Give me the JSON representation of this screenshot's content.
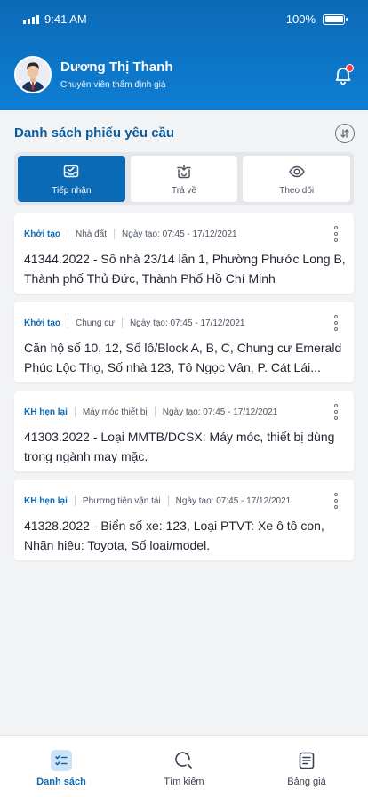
{
  "status_bar": {
    "time": "9:41 AM",
    "battery": "100%"
  },
  "user": {
    "name": "Dương Thị Thanh",
    "role": "Chuyên viên thẩm định giá"
  },
  "section": {
    "title": "Danh sách phiếu yêu cầu"
  },
  "tabs": [
    {
      "label": "Tiếp nhận",
      "icon": "inbox-check-icon",
      "active": true
    },
    {
      "label": "Trả về",
      "icon": "return-box-icon",
      "active": false
    },
    {
      "label": "Theo dõi",
      "icon": "eye-icon",
      "active": false
    }
  ],
  "requests": [
    {
      "status": "Khởi tạo",
      "category": "Nhà đất",
      "date": "Ngày tạo: 07:45 - 17/12/2021",
      "description": "41344.2022 - Số nhà 23/14 lần 1, Phường Phước Long B, Thành phố Thủ Đức, Thành Phố Hồ Chí Minh"
    },
    {
      "status": "Khởi tạo",
      "category": "Chung cư",
      "date": "Ngày tạo: 07:45 - 17/12/2021",
      "description": "Căn hộ số 10, 12, Số lô/Block A, B, C, Chung cư Emerald Phúc Lộc Thọ, Số nhà 123, Tô Ngọc Vân, P. Cát Lái..."
    },
    {
      "status": "KH hẹn lại",
      "category": "Máy móc thiết bị",
      "date": "Ngày tạo: 07:45 - 17/12/2021",
      "description": "41303.2022 - Loại MMTB/DCSX: Máy móc, thiết bị dùng trong ngành may mặc."
    },
    {
      "status": "KH hẹn lại",
      "category": "Phương tiện vận tải",
      "date": "Ngày tạo: 07:45 - 17/12/2021",
      "description": "41328.2022 - Biển số xe: 123, Loại PTVT: Xe ô tô con, Nhãn hiệu: Toyota, Số loại/model."
    }
  ],
  "bottom_nav": [
    {
      "label": "Danh sách",
      "icon": "checklist-icon",
      "active": true
    },
    {
      "label": "Tìm kiếm",
      "icon": "search-icon",
      "active": false
    },
    {
      "label": "Bảng giá",
      "icon": "document-icon",
      "active": false
    }
  ],
  "colors": {
    "primary": "#0b6ab6",
    "notification": "#ff3b3b",
    "background": "#f2f3f5"
  }
}
